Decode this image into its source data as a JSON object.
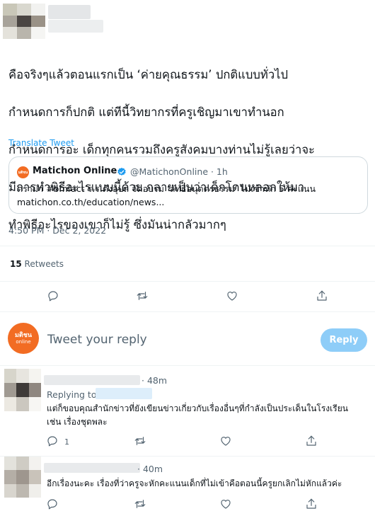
{
  "tweet": {
    "text_lines": [
      "คือจริงๆแล้วตอนแรกเป็น ‘ค่ายคุณธรรม’ ปกติแบบทั่วไป",
      "กำหนดการก็ปกติ แต่ทีนี้วิทยากรที่ครูเชิญมาเขาทำนอก",
      "กำหนดการอะ เด็กทุกคนรวมถึงครูสังคมบางท่านไม่รู้เลยว่าจะ",
      "มีการทำพิธีอะไรแบบนี้ด้วย กลายเป็นว่าเด็กโดนหลอกให้มา",
      "ทำพิธีอะไรของเขาก็ไม่รู้  ซึ่งมันน่ากลัวมากๆ"
    ],
    "translate_label": "Translate Tweet",
    "timestamp": "4:50 PM · Dec 2, 2022",
    "retweet_count": "15",
    "retweet_label": "Retweets"
  },
  "quote": {
    "avatar_text": "มติชน",
    "name": "Matichon Online",
    "handle": "@MatichonOnline · 1h",
    "text_line1": "ดราม่า #bmfact ร.ร.ดังอุบล จัดอบรม ‘ลัทธิอนุตตรธรรม’ ไม่เข้าหัก 5 คะแนน",
    "text_line2": "matichon.co.th/education/news..."
  },
  "composer": {
    "avatar_line1": "มติชน",
    "avatar_line2": "online",
    "placeholder": "Tweet your reply",
    "reply_button": "Reply"
  },
  "replies": [
    {
      "time": "· 48m",
      "replying_to": "Replying to",
      "text_line1": "แต่ก็ขอบคุณสำนักข่าวที่ยังเขียนข่าวเกี่ยวกับเรื่องอื่นๆที่กำลังเป็นประเด็นในโรงเรียน",
      "text_line2": "เช่น เรื่องชุดพละ",
      "reply_count": "1"
    },
    {
      "time": "· 40m",
      "text_line1": "อีกเรื่องนะคะ เรื่องที่ว่าครูจะหักคะแนนเด็กที่ไม่เข้าคือตอนนี้ครูยกเลิกไม่หักแล้วค่ะ"
    }
  ],
  "colors": {
    "accent": "#1d9bf0",
    "brand_orange": "#f26c23",
    "reply_button_disabled": "#8ecdf8",
    "secondary_text": "#536471"
  },
  "icons": [
    "reply-icon",
    "retweet-icon",
    "like-icon",
    "share-icon",
    "verified-badge-icon"
  ]
}
